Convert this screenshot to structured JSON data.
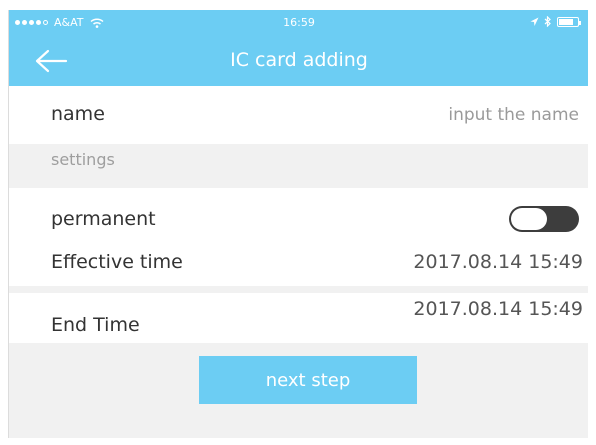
{
  "status_bar": {
    "carrier": "A&AT",
    "time": "16:59",
    "battery_level": 0.8
  },
  "nav": {
    "title": "IC card adding",
    "back_icon": "arrow-left-icon"
  },
  "form": {
    "name_label": "name",
    "name_placeholder": "input the name",
    "name_value": "",
    "section_label": "settings",
    "permanent_label": "permanent",
    "permanent_on": false,
    "effective_label": "Effective time",
    "effective_value": "2017.08.14 15:49",
    "end_label": "End Time",
    "end_value": "2017.08.14 15:49"
  },
  "actions": {
    "next_label": "next step"
  },
  "colors": {
    "accent": "#6ccdf3",
    "toggle_off": "#3d3d3d",
    "background": "#f1f1f1"
  }
}
